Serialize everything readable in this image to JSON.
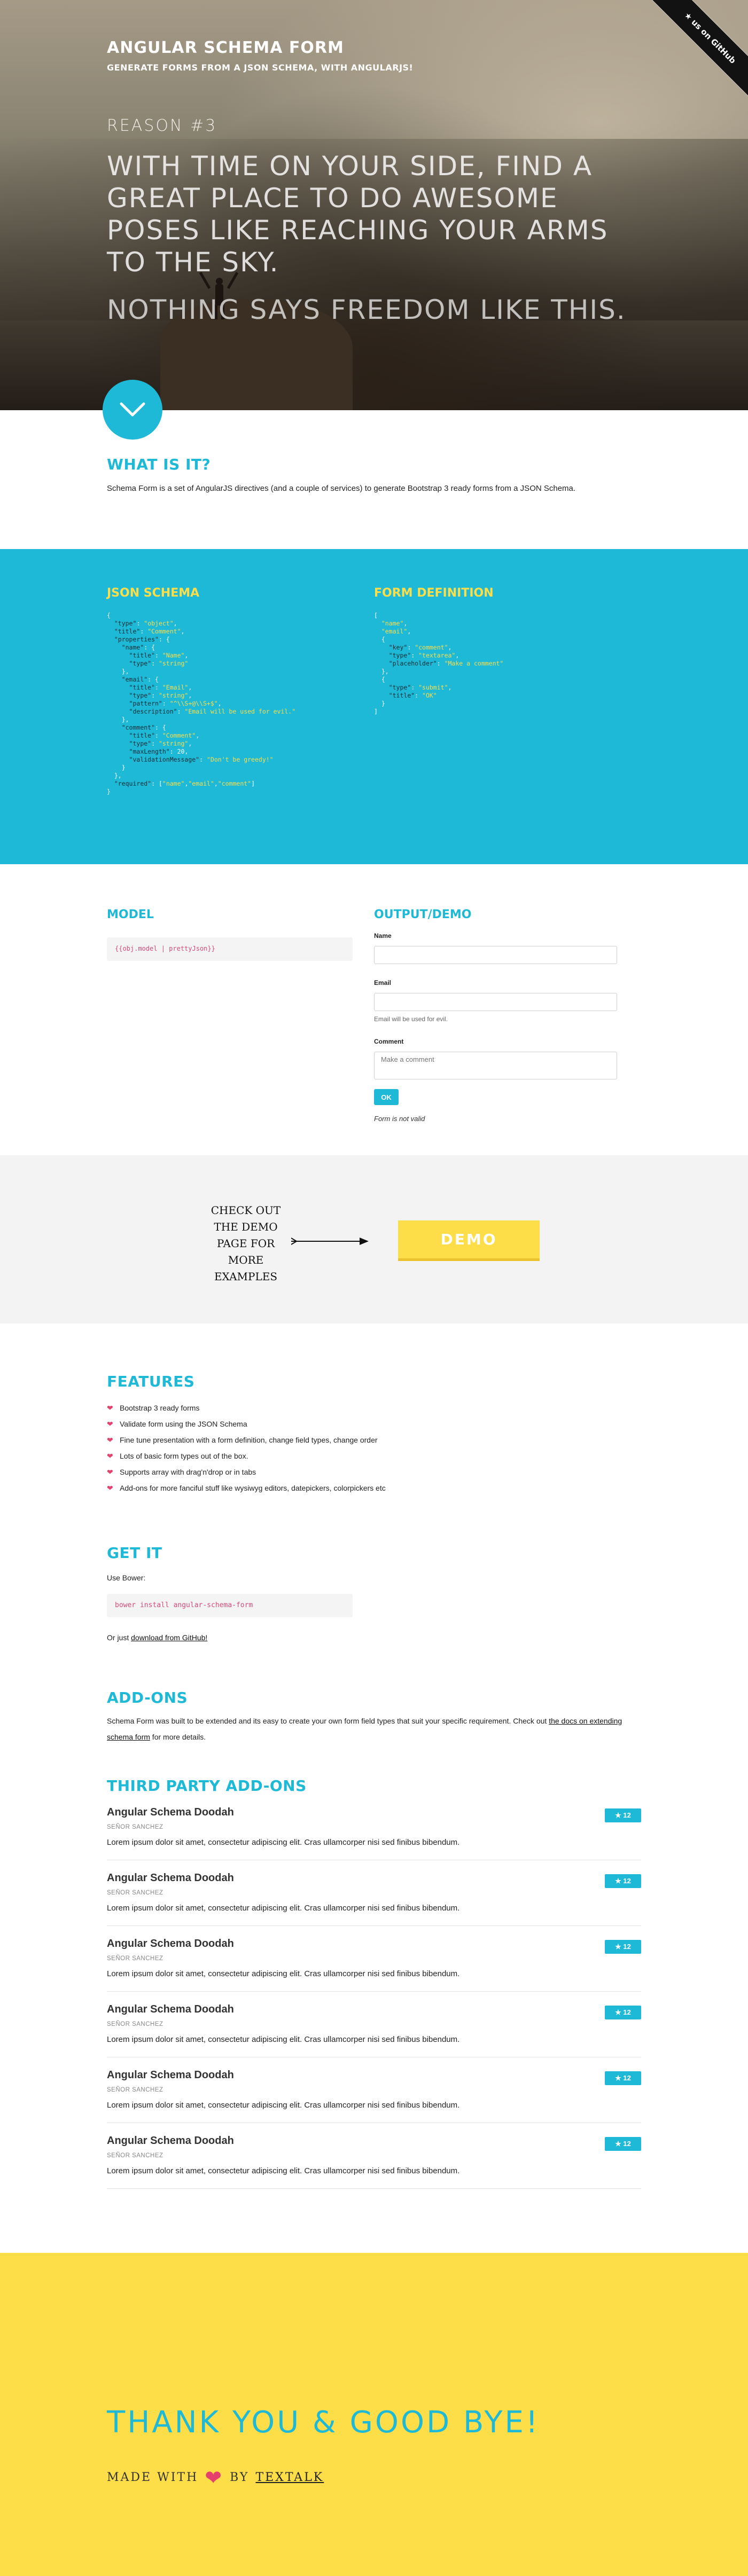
{
  "hero": {
    "title": "ANGULAR SCHEMA FORM",
    "subtitle": "GENERATE FORMS FROM A JSON SCHEMA, WITH ANGULARJS!",
    "reason": "REASON #3",
    "tagline": "WITH TIME ON YOUR SIDE, FIND A GREAT PLACE TO DO AWESOME POSES LIKE REACHING YOUR ARMS TO THE SKY.",
    "tagline2": "NOTHING SAYS FREEDOM LIKE THIS.",
    "ribbon": "★ us on GitHub"
  },
  "what": {
    "heading": "WHAT IS IT?",
    "text": "Schema Form is a set of AngularJS directives (and a couple of services) to generate Bootstrap 3 ready forms from a JSON Schema."
  },
  "schema": {
    "json_heading": "JSON SCHEMA",
    "form_heading": "FORM DEFINITION"
  },
  "model": {
    "heading": "MODEL",
    "binding": "{{obj.model | prettyJson}}",
    "output_heading": "OUTPUT/DEMO",
    "name_label": "Name",
    "email_label": "Email",
    "email_help": "Email will be used for evil.",
    "comment_label": "Comment",
    "comment_placeholder": "Make a comment",
    "ok_label": "OK",
    "status": "Form is not valid"
  },
  "cta": {
    "note": "CHECK OUT THE DEMO PAGE FOR MORE EXAMPLES",
    "demo_label": "DEMO"
  },
  "features": {
    "heading": "FEATURES",
    "items": [
      "Bootstrap 3 ready forms",
      "Validate form using the JSON Schema",
      "Fine tune presentation with a form definition, change field types, change order",
      "Lots of basic form types out of the box.",
      "Supports array with drag'n'drop or in tabs",
      "Add-ons for more fanciful stuff like wysiwyg editors, datepickers, colorpickers etc"
    ]
  },
  "getit": {
    "heading": "GET IT",
    "use_bower": "Use Bower:",
    "command": "bower install angular-schema-form",
    "or_just": "Or just ",
    "download_link": "download from GitHub!"
  },
  "addons": {
    "heading": "ADD-ONS",
    "text": "Schema Form was built to be extended and its easy to create your own form field types that suit your specific requirement. Check out ",
    "link": "the docs on extending schema form",
    "text_end": " for more details."
  },
  "third_party": {
    "heading": "THIRD PARTY ADD-ONS",
    "items": [
      {
        "name": "Angular Schema Doodah",
        "author": "SEÑOR SANCHEZ",
        "desc": "Lorem ipsum dolor sit amet, consectetur adipiscing elit. Cras ullamcorper nisi sed finibus bibendum.",
        "stars": "★ 12"
      },
      {
        "name": "Angular Schema Doodah",
        "author": "SEÑOR SANCHEZ",
        "desc": "Lorem ipsum dolor sit amet, consectetur adipiscing elit. Cras ullamcorper nisi sed finibus bibendum.",
        "stars": "★ 12"
      },
      {
        "name": "Angular Schema Doodah",
        "author": "SEÑOR SANCHEZ",
        "desc": "Lorem ipsum dolor sit amet, consectetur adipiscing elit. Cras ullamcorper nisi sed finibus bibendum.",
        "stars": "★ 12"
      },
      {
        "name": "Angular Schema Doodah",
        "author": "SEÑOR SANCHEZ",
        "desc": "Lorem ipsum dolor sit amet, consectetur adipiscing elit. Cras ullamcorper nisi sed finibus bibendum.",
        "stars": "★ 12"
      },
      {
        "name": "Angular Schema Doodah",
        "author": "SEÑOR SANCHEZ",
        "desc": "Lorem ipsum dolor sit amet, consectetur adipiscing elit. Cras ullamcorper nisi sed finibus bibendum.",
        "stars": "★ 12"
      },
      {
        "name": "Angular Schema Doodah",
        "author": "SEÑOR SANCHEZ",
        "desc": "Lorem ipsum dolor sit amet, consectetur adipiscing elit. Cras ullamcorper nisi sed finibus bibendum.",
        "stars": "★ 12"
      }
    ]
  },
  "footer": {
    "thanks": "THANK YOU & GOOD BYE!",
    "made_with": "MADE WITH",
    "by": "BY",
    "link": "TEXTALK"
  },
  "colors": {
    "accent": "#1eb9d6",
    "yellow": "#fdde49",
    "heart": "#e5416d"
  }
}
